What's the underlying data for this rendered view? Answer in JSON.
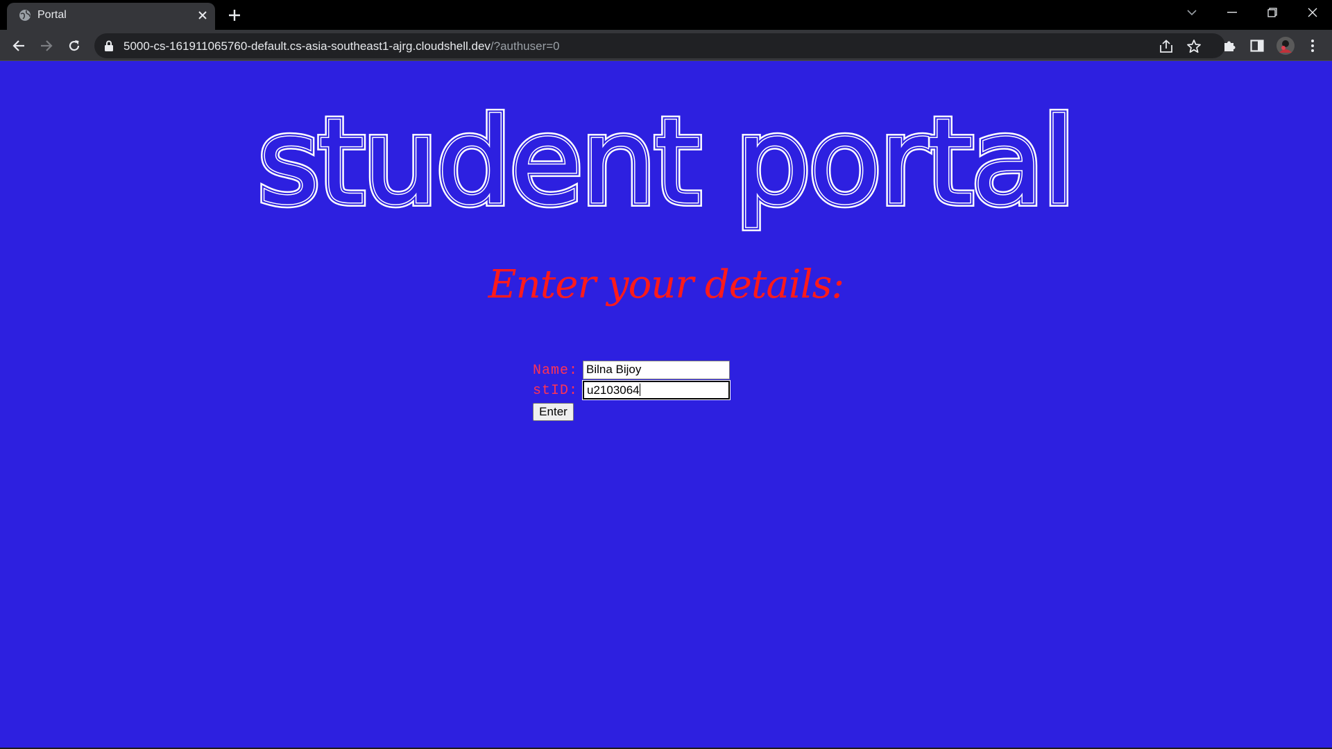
{
  "browser": {
    "tab_title": "Portal",
    "url_main": "5000-cs-161911065760-default.cs-asia-southeast1-ajrg.cloudshell.dev",
    "url_rest": "/?authuser=0"
  },
  "page": {
    "hero_title": "student portal",
    "subtitle": "Enter your details:",
    "form": {
      "name_label": "Name:",
      "name_value": "Bilna Bijoy",
      "stid_label": "stID:",
      "stid_value": "u2103064",
      "submit_label": "Enter"
    }
  },
  "colors": {
    "page_background": "#2d20e0",
    "hero_text": "#ffffff",
    "subtitle_text": "#ff1a1a",
    "label_text": "#ff3355"
  },
  "icons": {
    "favicon": "globe-icon",
    "tab_close": "close-icon",
    "new_tab": "plus-icon",
    "tab_search": "chevron-down-icon",
    "minimize": "minimize-icon",
    "restore": "restore-icon",
    "close_window": "close-icon",
    "back": "arrow-left-icon",
    "forward": "arrow-right-icon",
    "reload": "reload-icon",
    "lock": "lock-icon",
    "share": "share-icon",
    "bookmark": "star-icon",
    "extensions": "puzzle-icon",
    "side_panel": "side-panel-icon",
    "profile": "avatar-icon",
    "menu": "kebab-menu-icon"
  }
}
